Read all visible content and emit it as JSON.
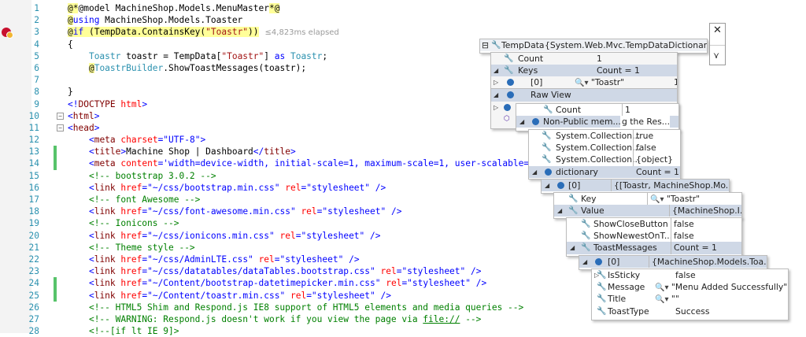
{
  "editor": {
    "lines": [
      {
        "n": "1",
        "html": "<span class='razor'>@*</span><span>@model MachineShop.Models.MenuMaster</span><span class='razor'>*@</span>"
      },
      {
        "n": "2",
        "html": "<span class='razor'>@</span><span class='kw'>using</span> MachineShop.Models.Toaster"
      },
      {
        "n": "3",
        "html": "<span class='razor'>@</span><span class='razor'><span class='kw'>if</span> (TempData.ContainsKey(<span class='str'>\"Toastr\"</span>))</span>"
      },
      {
        "n": "4",
        "html": "{"
      },
      {
        "n": "5",
        "html": "    <span class='ty'>Toastr</span> toastr = TempData[<span class='str'>\"Toastr\"</span>] <span class='kw'>as</span> <span class='ty'>Toastr</span>;"
      },
      {
        "n": "6",
        "html": "    <span class='razor'>@</span><span class='ty'>ToastrBuilder</span>.ShowToastMessages(toastr);"
      },
      {
        "n": "7",
        "html": ""
      },
      {
        "n": "8",
        "html": "}"
      },
      {
        "n": "9",
        "html": "<span class='val'>&lt;!</span><span class='tag'>DOCTYPE</span> <span class='attr'>html</span><span class='val'>&gt;</span>"
      },
      {
        "n": "10",
        "html": "<span class='val'>&lt;</span><span class='tag'>html</span><span class='val'>&gt;</span>"
      },
      {
        "n": "11",
        "html": "<span class='val'>&lt;</span><span class='tag'>head</span><span class='val'>&gt;</span>"
      },
      {
        "n": "12",
        "html": "    <span class='val'>&lt;</span><span class='tag'>meta</span> <span class='attr'>charset</span><span class='val'>=\"UTF-8\"&gt;</span>"
      },
      {
        "n": "13",
        "html": "    <span class='val'>&lt;</span><span class='tag'>title</span><span class='val'>&gt;</span>Machine Shop | Dashboard<span class='val'>&lt;/</span><span class='tag'>title</span><span class='val'>&gt;</span>"
      },
      {
        "n": "14",
        "html": "    <span class='val'>&lt;</span><span class='tag'>meta</span> <span class='attr'>content</span><span class='val'>='width=device-width, initial-scale=1, maximum-scale=1, user-scalable=no'</span>"
      },
      {
        "n": "15",
        "html": "    <span class='cm'>&lt;!-- bootstrap 3.0.2 --&gt;</span>"
      },
      {
        "n": "16",
        "html": "    <span class='val'>&lt;</span><span class='tag'>link</span> <span class='attr'>href</span><span class='val'>=\"~/css/bootstrap.min.css\"</span> <span class='attr'>rel</span><span class='val'>=\"stylesheet\"</span> <span class='val'>/&gt;</span>"
      },
      {
        "n": "17",
        "html": "    <span class='cm'>&lt;!-- font Awesome --&gt;</span>"
      },
      {
        "n": "18",
        "html": "    <span class='val'>&lt;</span><span class='tag'>link</span> <span class='attr'>href</span><span class='val'>=\"~/css/font-awesome.min.css\"</span> <span class='attr'>rel</span><span class='val'>=\"stylesheet\"</span> <span class='val'>/&gt;</span>"
      },
      {
        "n": "19",
        "html": "    <span class='cm'>&lt;!-- Ionicons --&gt;</span>"
      },
      {
        "n": "20",
        "html": "    <span class='val'>&lt;</span><span class='tag'>link</span> <span class='attr'>href</span><span class='val'>=\"~/css/ionicons.min.css\"</span> <span class='attr'>rel</span><span class='val'>=\"stylesheet\"</span> <span class='val'>/&gt;</span>"
      },
      {
        "n": "21",
        "html": "    <span class='cm'>&lt;!-- Theme style --&gt;</span>"
      },
      {
        "n": "22",
        "html": "    <span class='val'>&lt;</span><span class='tag'>link</span> <span class='attr'>href</span><span class='val'>=\"~/css/AdminLTE.css\"</span> <span class='attr'>rel</span><span class='val'>=\"stylesheet\"</span> <span class='val'>/&gt;</span>"
      },
      {
        "n": "23",
        "html": "    <span class='val'>&lt;</span><span class='tag'>link</span> <span class='attr'>href</span><span class='val'>=\"~/css/datatables/dataTables.bootstrap.css\"</span> <span class='attr'>rel</span><span class='val'>=\"stylesheet\"</span> <span class='val'>/&gt;</span>"
      },
      {
        "n": "24",
        "html": "    <span class='val'>&lt;</span><span class='tag'>link</span> <span class='attr'>href</span><span class='val'>=\"~/Content/bootstrap-datetimepicker.min.css\"</span> <span class='attr'>rel</span><span class='val'>=\"stylesheet\"</span> <span class='val'>/&gt;</span>"
      },
      {
        "n": "25",
        "html": "    <span class='val'>&lt;</span><span class='tag'>link</span> <span class='attr'>href</span><span class='val'>=\"~/Content/toastr.min.css\"</span> <span class='attr'>rel</span><span class='val'>=\"stylesheet\"</span> <span class='val'>/&gt;</span>"
      },
      {
        "n": "26",
        "html": "    <span class='cm'>&lt;!-- HTML5 Shim and Respond.js IE8 support of HTML5 elements and media queries --&gt;</span>"
      },
      {
        "n": "27",
        "html": "    <span class='cm'>&lt;!-- WARNING: Respond.js doesn't work if you view the page via <u>file://</u> --&gt;</span>"
      },
      {
        "n": "28",
        "html": "    <span class='cm'>&lt;!--[if lt IE 9]&gt;</span>"
      }
    ],
    "elapsed": "≤4,823ms elapsed"
  },
  "datatips": {
    "root": {
      "name": "TempData",
      "value": "{System.Web.Mvc.TempDataDictionary}"
    },
    "level1": [
      {
        "name": "Count",
        "value": "1"
      },
      {
        "name": "Keys",
        "value": "Count = 1"
      },
      {
        "name": "[0]",
        "value": "\"Toastr\"",
        "extra": "1"
      },
      {
        "name": "Raw View",
        "value": ""
      }
    ],
    "level2": [
      {
        "name": "Count",
        "value": "1"
      },
      {
        "name": "Non-Public mem...",
        "value": "g the Res..."
      }
    ],
    "level3": [
      {
        "name": "System.Collection...",
        "value": "true"
      },
      {
        "name": "System.Collection...",
        "value": "false"
      },
      {
        "name": "System.Collection...",
        "value": "{object}"
      },
      {
        "name": "dictionary",
        "value": "Count = 1"
      }
    ],
    "level4": [
      {
        "name": "[0]",
        "value": "{[Toastr, MachineShop.Mo..."
      }
    ],
    "level5": [
      {
        "name": "Key",
        "value": "\"Toastr\""
      },
      {
        "name": "Value",
        "value": "{MachineShop.I..."
      }
    ],
    "level6": [
      {
        "name": "ShowCloseButton",
        "value": "false"
      },
      {
        "name": "ShowNewestOnT...",
        "value": "false"
      },
      {
        "name": "ToastMessages",
        "value": "Count = 1"
      }
    ],
    "level7": [
      {
        "name": "[0]",
        "value": "{MachineShop.Models.Toa..."
      }
    ],
    "level8": [
      {
        "name": "IsSticky",
        "value": "false"
      },
      {
        "name": "Message",
        "value": "\"Menu Added Successfully\""
      },
      {
        "name": "Title",
        "value": "\"\""
      },
      {
        "name": "ToastType",
        "value": "Success"
      }
    ]
  }
}
